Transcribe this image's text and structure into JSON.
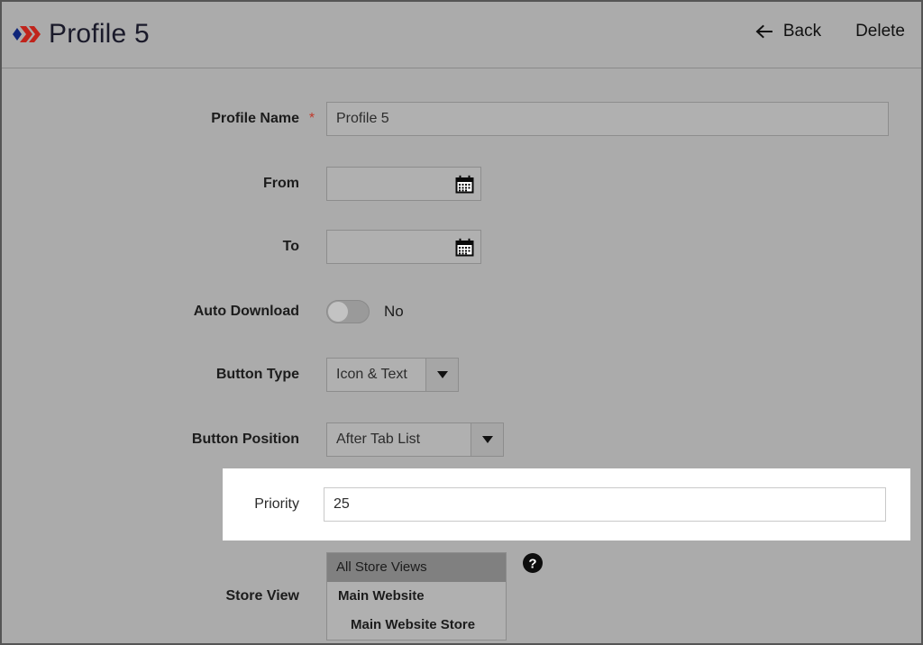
{
  "header": {
    "logo_icon": "chevrons-logo-icon",
    "title": "Profile 5",
    "back_label": "Back",
    "back_icon": "arrow-left-icon",
    "delete_label": "Delete"
  },
  "form": {
    "profile_name": {
      "label": "Profile Name",
      "required_marker": "*",
      "value": "Profile 5"
    },
    "from": {
      "label": "From",
      "value": "",
      "icon": "calendar-icon"
    },
    "to": {
      "label": "To",
      "value": "",
      "icon": "calendar-icon"
    },
    "auto_download": {
      "label": "Auto Download",
      "state_label": "No",
      "checked": false
    },
    "button_type": {
      "label": "Button Type",
      "value": "Icon & Text",
      "caret_icon": "chevron-down-icon"
    },
    "button_position": {
      "label": "Button Position",
      "value": "After Tab List",
      "caret_icon": "chevron-down-icon"
    },
    "priority": {
      "label": "Priority",
      "value": "25"
    },
    "store_view": {
      "label": "Store View",
      "help_icon": "help-question-icon",
      "options": [
        {
          "label": "All Store Views",
          "level": "all",
          "selected": true
        },
        {
          "label": "Main Website",
          "level": "website",
          "selected": false
        },
        {
          "label": "Main Website Store",
          "level": "store",
          "selected": false
        }
      ]
    }
  },
  "colors": {
    "page_background": "#ababab",
    "field_background": "#b0b0b0",
    "highlight_background": "#ffffff",
    "selected_option": "#808080",
    "required_star": "#c0392b",
    "logo_red": "#c0241c",
    "logo_blue": "#10267a"
  }
}
